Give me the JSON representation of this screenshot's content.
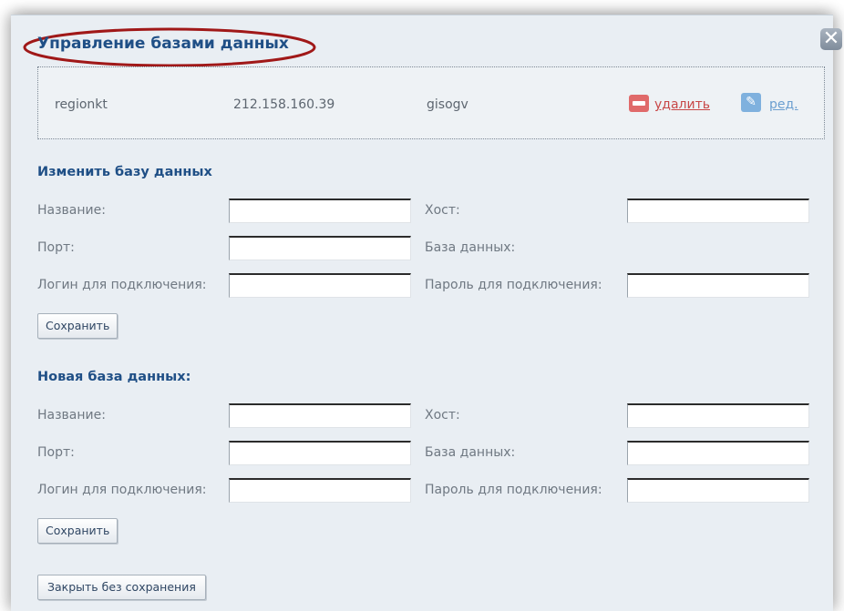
{
  "dialog": {
    "title": "Управление базами данных",
    "close_symbol": "✕"
  },
  "databases": [
    {
      "name": "regionkt",
      "host": "212.158.160.39",
      "db": "gisogv",
      "delete_label": "удалить",
      "edit_label": "ред."
    }
  ],
  "edit_form": {
    "title": "Изменить базу данных",
    "name_label": "Название:",
    "host_label": "Хост:",
    "port_label": "Порт:",
    "db_label": "База данных:",
    "login_label": "Логин для подключения:",
    "password_label": "Пароль для подключения:",
    "save_label": "Сохранить"
  },
  "new_form": {
    "title": "Новая база данных:",
    "name_label": "Название:",
    "host_label": "Хост:",
    "port_label": "Порт:",
    "db_label": "База данных:",
    "login_label": "Логин для подключения:",
    "password_label": "Пароль для подключения:",
    "save_label": "Сохранить"
  },
  "close_no_save_label": "Закрыть без сохранения",
  "icons": [
    "close-icon",
    "delete-icon",
    "edit-pen-icon"
  ],
  "colors": {
    "title": "#1f4f86",
    "delete": "#c84848",
    "edit": "#6b9fd0",
    "highlight_ellipse": "#a01818"
  }
}
